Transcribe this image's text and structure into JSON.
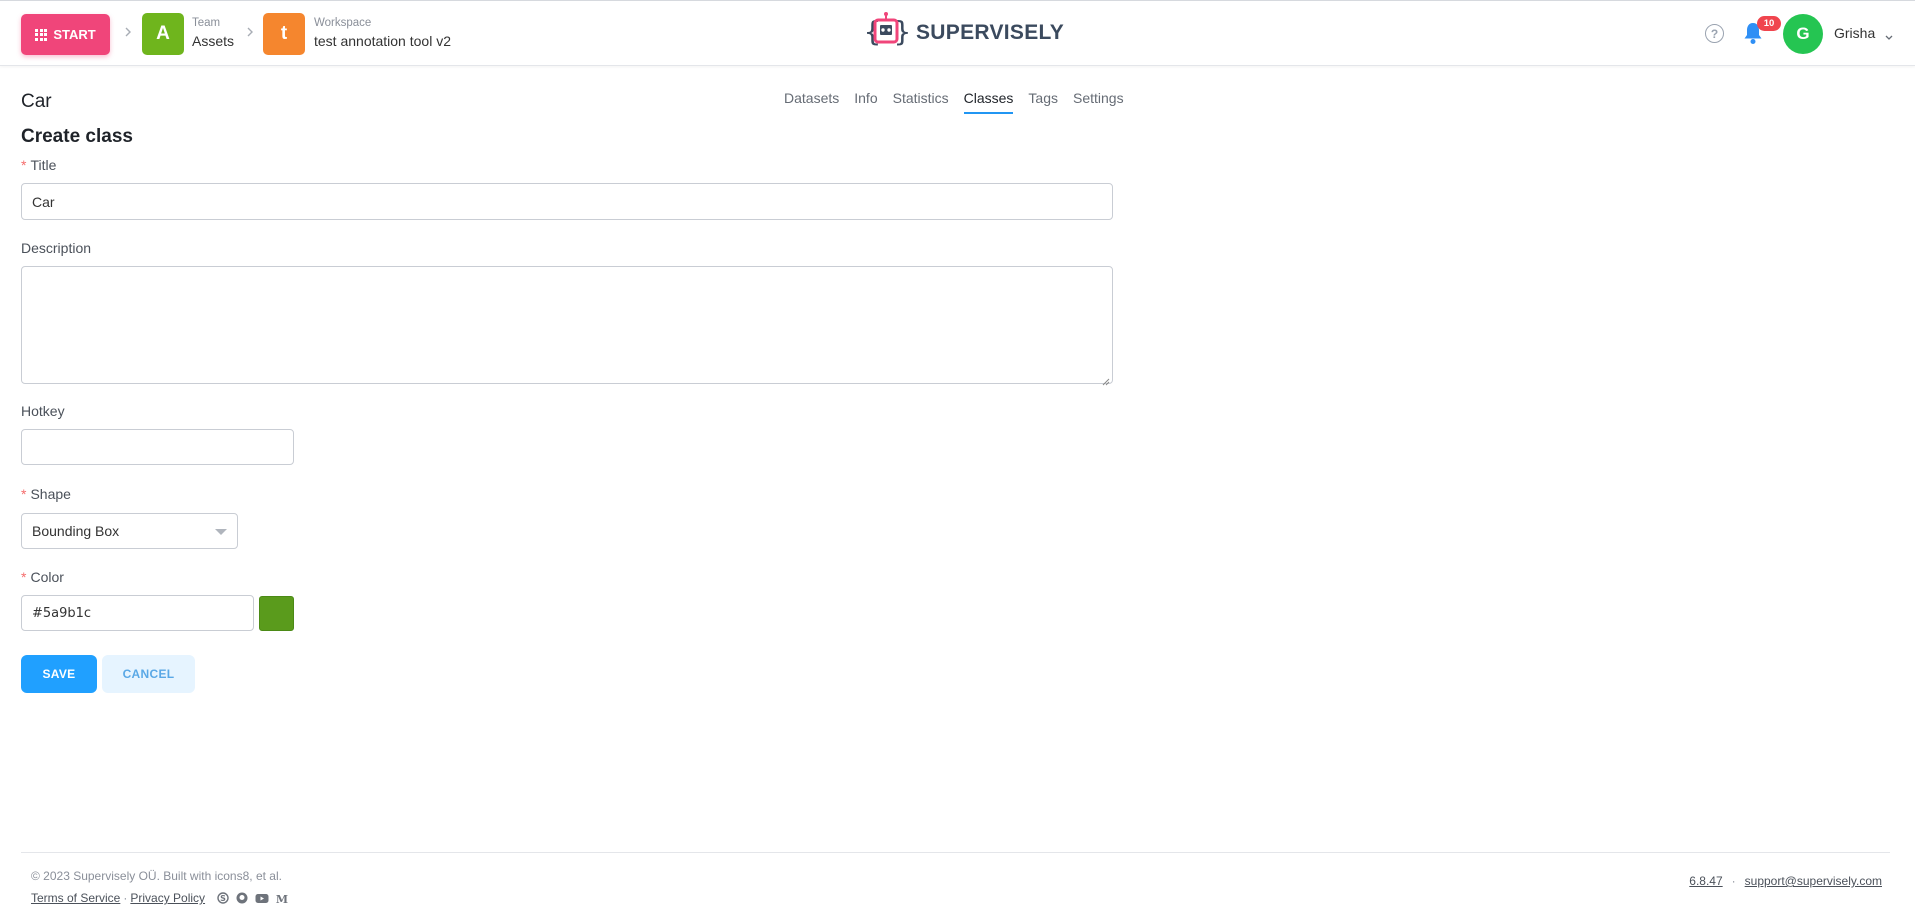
{
  "header": {
    "start_label": "START",
    "team": {
      "initial": "A",
      "caption": "Team",
      "name": "Assets",
      "color": "#6fb51d"
    },
    "workspace": {
      "initial": "t",
      "caption": "Workspace",
      "name": "test annotation tool v2",
      "color": "#f5862e"
    },
    "logo_text": "SUPERVISELY",
    "notifications_count": "10",
    "user_initial": "G",
    "user_name": "Grisha"
  },
  "page": {
    "project_title": "Car",
    "tabs": [
      "Datasets",
      "Info",
      "Statistics",
      "Classes",
      "Tags",
      "Settings"
    ],
    "active_tab": "Classes",
    "section_title": "Create class"
  },
  "form": {
    "title_label": "Title",
    "title_value": "Car",
    "description_label": "Description",
    "description_value": "",
    "hotkey_label": "Hotkey",
    "hotkey_value": "",
    "shape_label": "Shape",
    "shape_value": "Bounding Box",
    "color_label": "Color",
    "color_value": "#5a9b1c",
    "save_label": "SAVE",
    "cancel_label": "CANCEL"
  },
  "footer": {
    "copyright": "© 2023 Supervisely OÜ. Built with icons8, et al.",
    "terms": "Terms of Service",
    "privacy": "Privacy Policy",
    "version": "6.8.47",
    "support_email": "support@supervisely.com"
  },
  "colors": {
    "accent": "#20a0ff",
    "start": "#f0457a",
    "avatar": "#25c552",
    "badge": "#f0454e"
  },
  "icons": [
    "grid-icon",
    "chevron-right-icon",
    "robot-logo-icon",
    "help-icon",
    "bell-icon",
    "chevron-down-icon",
    "caret-down-icon",
    "skype-icon",
    "github-icon",
    "youtube-icon",
    "medium-icon"
  ]
}
